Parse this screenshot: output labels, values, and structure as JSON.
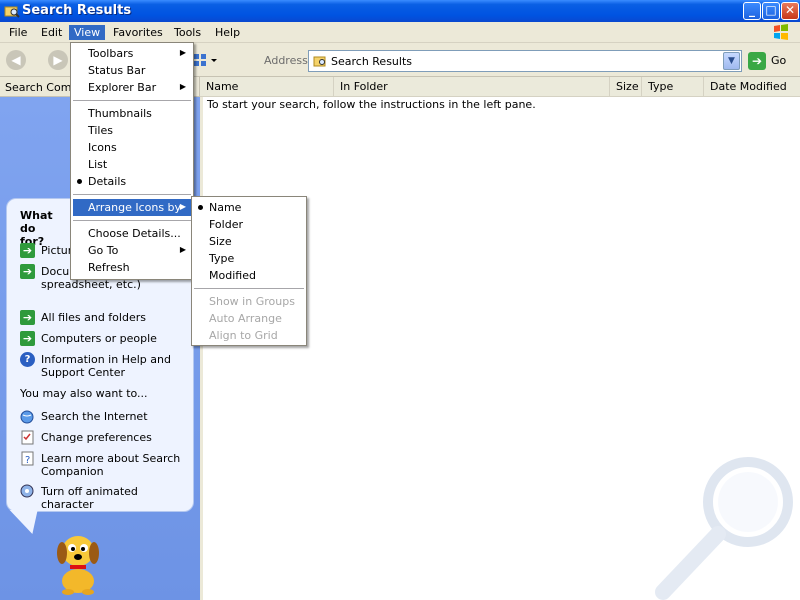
{
  "window": {
    "title": "Search Results",
    "buttons": {
      "minimize": "_",
      "maximize": "□",
      "close": "✕"
    }
  },
  "menubar": [
    "File",
    "Edit",
    "View",
    "Favorites",
    "Tools",
    "Help"
  ],
  "toolbar": {
    "address_label": "Address",
    "address_value": "Search Results",
    "go_label": "Go"
  },
  "left_pane": {
    "header": "Search Comp",
    "heading": "What do for?",
    "items": [
      "Pictur",
      "Docum processing, spreadsheet, etc.)",
      "All files and folders",
      "Computers or people",
      "Information in Help and Support Center"
    ],
    "also_label": "You may also want to...",
    "also_items": [
      "Search the Internet",
      "Change preferences",
      "Learn more about Search Companion",
      "Turn off animated character"
    ]
  },
  "list": {
    "columns": [
      "Name",
      "In Folder",
      "Size",
      "Type",
      "Date Modified"
    ],
    "message": "To start your search, follow the instructions in the left pane."
  },
  "view_menu": {
    "items": [
      "Toolbars",
      "Status Bar",
      "Explorer Bar",
      "Thumbnails",
      "Tiles",
      "Icons",
      "List",
      "Details",
      "Arrange Icons by",
      "Choose Details...",
      "Go To",
      "Refresh"
    ]
  },
  "arrange_menu": {
    "items": [
      "Name",
      "Folder",
      "Size",
      "Type",
      "Modified",
      "Show in Groups",
      "Auto Arrange",
      "Align to Grid"
    ]
  },
  "colors": {
    "highlight": "#316ac5",
    "titlebar": "#0053e1",
    "left_pane": "#7aa0ee"
  }
}
